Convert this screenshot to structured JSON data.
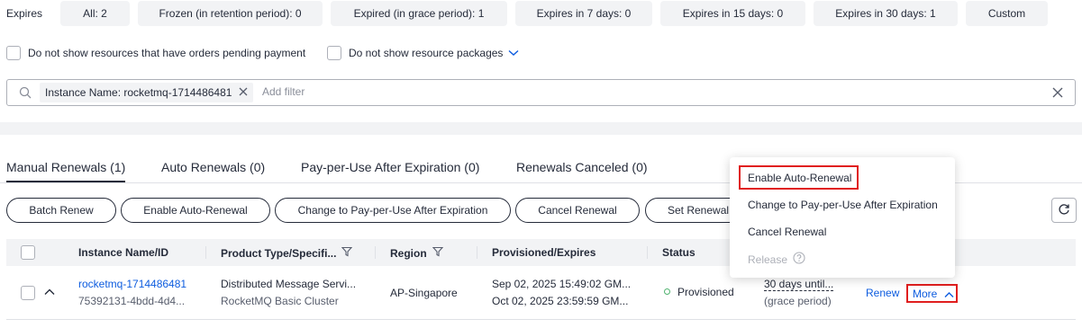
{
  "filters": {
    "label": "Expires",
    "chips": [
      "All: 2",
      "Frozen (in retention period): 0",
      "Expired (in grace period): 1",
      "Expires in 7 days: 0",
      "Expires in 15 days: 0",
      "Expires in 30 days: 1",
      "Custom"
    ]
  },
  "options": {
    "pending_payment": "Do not show resources that have orders pending payment",
    "resource_packages": "Do not show resource packages"
  },
  "search": {
    "tag": "Instance Name: rocketmq-1714486481",
    "placeholder": "Add filter"
  },
  "tabs": [
    "Manual Renewals (1)",
    "Auto Renewals (0)",
    "Pay-per-Use After Expiration (0)",
    "Renewals Canceled (0)"
  ],
  "actions": {
    "batch_renew": "Batch Renew",
    "enable_auto_renewal": "Enable Auto-Renewal",
    "change_ppu": "Change to Pay-per-Use After Expiration",
    "cancel_renewal": "Cancel Renewal",
    "set_renewal": "Set Renewal"
  },
  "table": {
    "headers": {
      "instance": "Instance Name/ID",
      "product": "Product Type/Specifi...",
      "region": "Region",
      "provisioned": "Provisioned/Expires",
      "status": "Status"
    },
    "row": {
      "name": "rocketmq-1714486481",
      "id": "75392131-4bdd-4d4...",
      "product_type": "Distributed Message Servi...",
      "product_spec": "RocketMQ Basic Cluster",
      "region": "AP-Singapore",
      "provisioned": "Sep 02, 2025 15:49:02 GM...",
      "expires": "Oct 02, 2025 23:59:59 GM...",
      "status": "Provisioned",
      "remaining": "30 days until...",
      "remaining_note": "(grace period)",
      "renew": "Renew",
      "more": "More"
    }
  },
  "menu": {
    "items": [
      "Enable Auto-Renewal",
      "Change to Pay-per-Use After Expiration",
      "Cancel Renewal",
      "Release"
    ]
  },
  "colors": {
    "link": "#0d5cdf",
    "highlight": "#e01e1e",
    "status_ok": "#50b370"
  }
}
